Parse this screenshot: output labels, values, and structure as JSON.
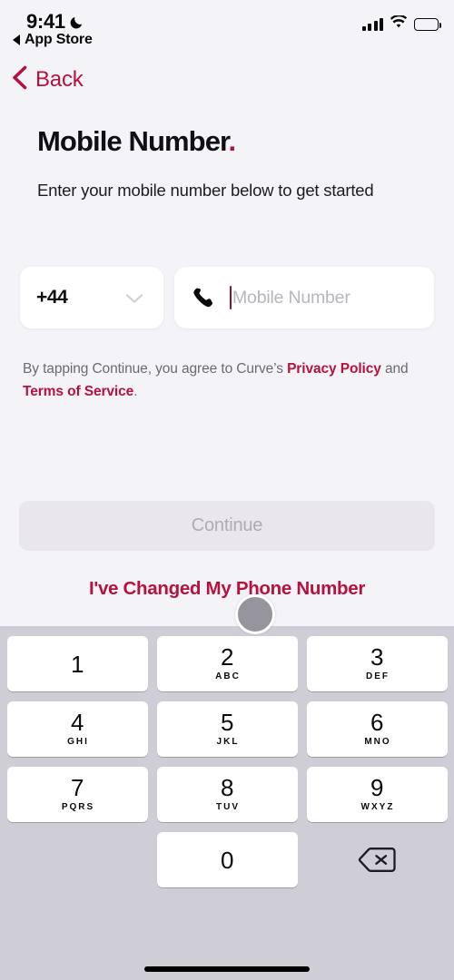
{
  "status_bar": {
    "time": "9:41",
    "dnd_icon": "moon-icon",
    "return_arrow_icon": "back-triangle-icon",
    "return_app_label": "App Store",
    "cellular_icon": "signal-bars-icon",
    "wifi_icon": "wifi-icon",
    "battery_icon": "battery-icon"
  },
  "nav": {
    "back_icon": "chevron-left-icon",
    "back_label": "Back"
  },
  "header": {
    "title": "Mobile Number",
    "title_period": ".",
    "subtitle": "Enter your mobile number below to get started"
  },
  "form": {
    "country_code": {
      "value": "+44",
      "chevron_icon": "chevron-down-icon"
    },
    "phone": {
      "icon": "phone-handset-icon",
      "value": "",
      "placeholder": "Mobile Number"
    }
  },
  "legal": {
    "prefix": "By tapping Continue, you agree to Curve’s ",
    "privacy_link": "Privacy Policy",
    "middle": " and ",
    "terms_link": "Terms of Service",
    "suffix": "."
  },
  "actions": {
    "continue_label": "Continue",
    "continue_enabled": false,
    "changed_number_label": "I've Changed My Phone Number"
  },
  "keypad": {
    "keys": [
      {
        "digit": "1",
        "letters": ""
      },
      {
        "digit": "2",
        "letters": "ABC"
      },
      {
        "digit": "3",
        "letters": "DEF"
      },
      {
        "digit": "4",
        "letters": "GHI"
      },
      {
        "digit": "5",
        "letters": "JKL"
      },
      {
        "digit": "6",
        "letters": "MNO"
      },
      {
        "digit": "7",
        "letters": "PQRS"
      },
      {
        "digit": "8",
        "letters": "TUV"
      },
      {
        "digit": "9",
        "letters": "WXYZ"
      },
      {
        "digit": "0",
        "letters": ""
      }
    ],
    "delete_icon": "delete-backspace-icon"
  },
  "cursor": {
    "icon": "pointer-circle-cursor"
  },
  "home_indicator": {
    "icon": "home-indicator-bar"
  },
  "colors": {
    "accent": "#b5123e",
    "page_background": "#f4f3f7",
    "keyboard_background": "#cfced6",
    "disabled_button": "#e9e7ec",
    "disabled_text": "#aeacb4"
  }
}
